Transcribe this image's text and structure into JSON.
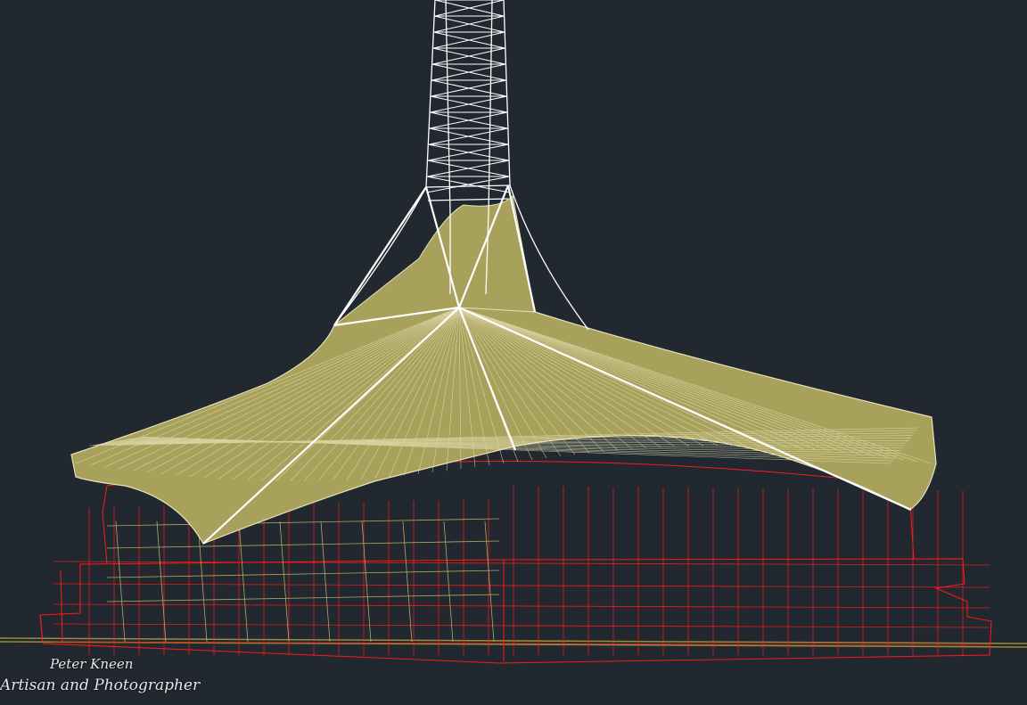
{
  "viewport": {
    "background": "#212830",
    "colors": {
      "spire": "#ffffff",
      "canopy_fill": "#a8a15c",
      "canopy_mesh": "#e7e2b6",
      "building": "#ff1a1a",
      "building_secondary": "#c8c070",
      "ground": "#9a8a3a"
    }
  },
  "watermark": {
    "name": "Peter Kneen",
    "tagline": "Artisan and Photographer"
  }
}
